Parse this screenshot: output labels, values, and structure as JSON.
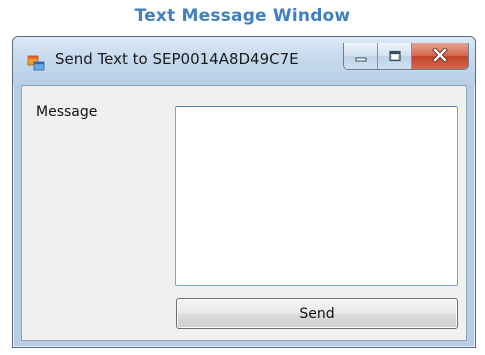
{
  "caption": "Text Message Window",
  "window": {
    "title": "Send Text to SEP0014A8D49C7E",
    "icon": "app-window-icon",
    "controls": [
      "minimize-icon",
      "maximize-icon",
      "close-icon"
    ]
  },
  "form": {
    "message_label": "Message",
    "message_value": "",
    "send_label": "Send"
  },
  "colors": {
    "caption": "#3f7fc2",
    "titlebar": "#c6d9ee",
    "close_button": "#c14328",
    "client": "#f0f0f0"
  }
}
